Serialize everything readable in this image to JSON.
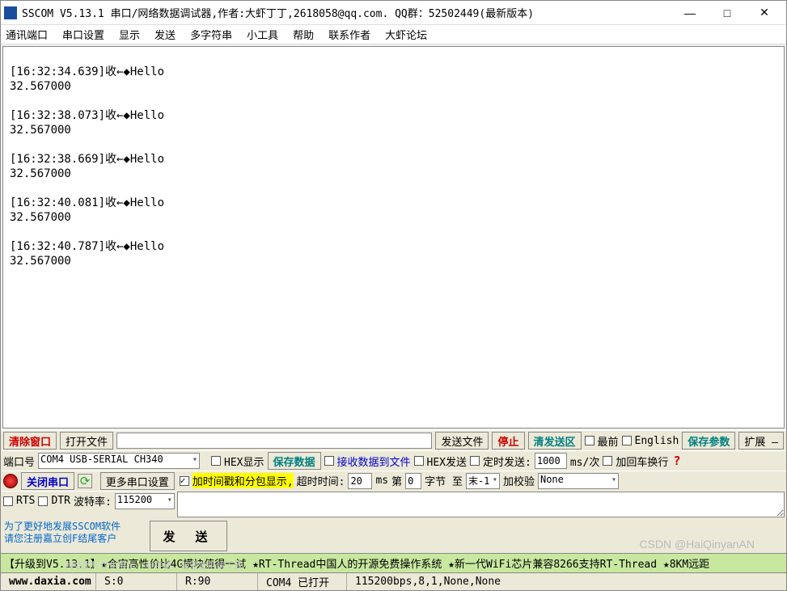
{
  "window": {
    "title": "SSCOM V5.13.1 串口/网络数据调试器,作者:大虾丁丁,2618058@qq.com. QQ群：52502449(最新版本)",
    "minimize": "—",
    "maximize": "□",
    "close": "✕"
  },
  "menu": [
    "通讯端口",
    "串口设置",
    "显示",
    "发送",
    "多字符串",
    "小工具",
    "帮助",
    "联系作者",
    "大虾论坛"
  ],
  "rx_log": "\n[16:32:34.639]收←◆Hello\n32.567000\n\n[16:32:38.073]收←◆Hello\n32.567000\n\n[16:32:38.669]收←◆Hello\n32.567000\n\n[16:32:40.081]收←◆Hello\n32.567000\n\n[16:32:40.787]收←◆Hello\n32.567000",
  "row1": {
    "clear": "清除窗口",
    "open_file": "打开文件",
    "file_path": "",
    "send_file": "发送文件",
    "stop": "停止",
    "clear_tx": "清发送区",
    "topmost": "最前",
    "english": "English",
    "save_params": "保存参数",
    "expand": "扩展 —"
  },
  "row2": {
    "port_label": "端口号",
    "port_value": "COM4 USB-SERIAL CH340",
    "hex_show": "HEX显示",
    "save_data": "保存数据",
    "rx_to_file": "接收数据到文件",
    "hex_send": "HEX发送",
    "timed_send": "定时发送:",
    "period": "1000",
    "period_unit": "ms/次",
    "add_crlf": "加回车换行"
  },
  "row3": {
    "close_port": "关闭串口",
    "more_settings": "更多串口设置",
    "timestamp": "加时间戳和分包显示,",
    "timeout_label": "超时时间:",
    "timeout": "20",
    "timeout_unit": "ms",
    "nth_label1": "第",
    "nth_val": "0",
    "nth_label2": "字节 至",
    "end_val": "末-1",
    "checksum_label": "加校验",
    "checksum_val": "None"
  },
  "row4": {
    "rts": "RTS",
    "dtr": "DTR",
    "baud_label": "波特率:",
    "baud": "115200"
  },
  "info_lines": [
    "为了更好地发展SSCOM软件",
    "请您注册嘉立创F结尾客户"
  ],
  "send_btn": "发 送",
  "banner": "【升级到V5.13.1】★合宙高性价比4G模块值得一试  ★RT-Thread中国人的开源免费操作系统  ★新一代WiFi芯片兼容8266支持RT-Thread  ★8KM远距",
  "status": {
    "site": "www.daxia.com",
    "s": "S:0",
    "r": "R:90",
    "port": "COM4 已打开",
    "params": "115200bps,8,1,None,None"
  },
  "watermark": "CSDN @HaiQinyanAN",
  "faint": "网络图片仅供展示，非存储，如需使用请下载。"
}
